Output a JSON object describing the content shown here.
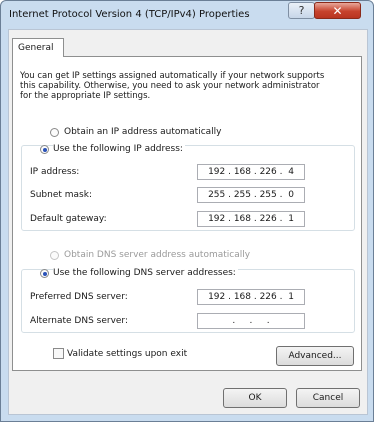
{
  "window": {
    "title": "Internet Protocol Version 4 (TCP/IPv4) Properties",
    "help_glyph": "?",
    "close_glyph": "✕"
  },
  "tabs": [
    {
      "label": "General"
    }
  ],
  "general": {
    "description": "You can get IP settings assigned automatically if your network supports\nthis capability. Otherwise, you need to ask your network administrator\nfor the appropriate IP settings.",
    "ip_mode": {
      "auto_label": "Obtain an IP address automatically",
      "manual_label": "Use the following IP address:",
      "selected": "manual"
    },
    "ip_fields": {
      "ip_address": {
        "label": "IP address:",
        "value": "192 . 168 . 226 .  4"
      },
      "subnet_mask": {
        "label": "Subnet mask:",
        "value": "255 . 255 . 255 .  0"
      },
      "default_gateway": {
        "label": "Default gateway:",
        "value": "192 . 168 . 226 .  1"
      }
    },
    "dns_mode": {
      "auto_label": "Obtain DNS server address automatically",
      "manual_label": "Use the following DNS server addresses:",
      "selected": "manual",
      "auto_disabled": true
    },
    "dns_fields": {
      "preferred": {
        "label": "Preferred DNS server:",
        "value": "192 . 168 . 226 .  1"
      },
      "alternate": {
        "label": "Alternate DNS server:",
        "value": "  .     .     .  "
      }
    },
    "validate": {
      "label": "Validate settings upon exit",
      "checked": false
    },
    "advanced_label": "Advanced..."
  },
  "footer": {
    "ok_label": "OK",
    "cancel_label": "Cancel"
  }
}
